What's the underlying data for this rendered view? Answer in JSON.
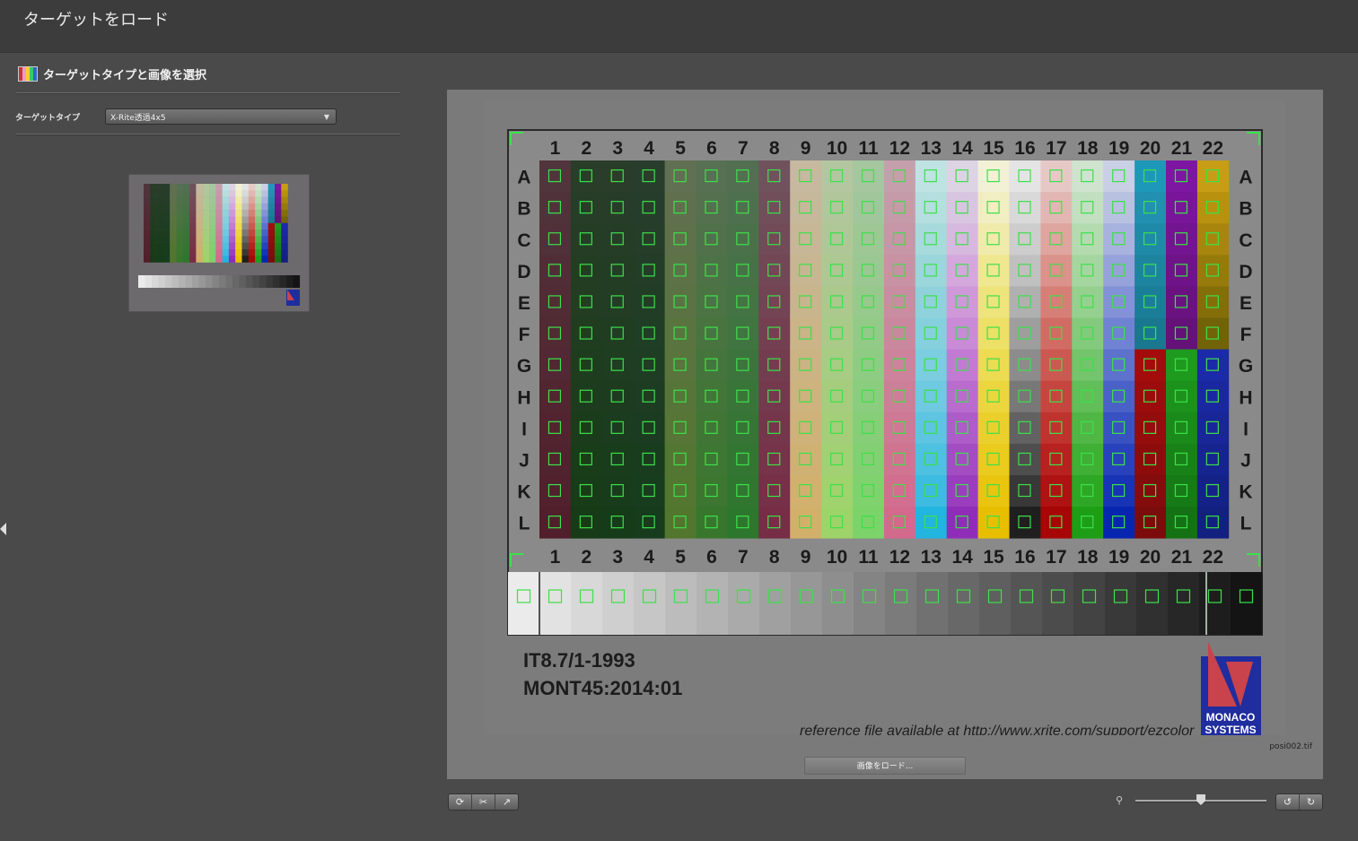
{
  "window": {
    "title": "ターゲットをロード"
  },
  "section": {
    "title": "ターゲットタイプと画像を選択"
  },
  "target_type": {
    "label": "ターゲットタイプ",
    "selected": "X-Rite透過4x5"
  },
  "icons": {
    "section": "target-image-icon",
    "collapse": "triangle-left-icon",
    "dropdown": "chevron-down-icon",
    "tools": [
      "rotate-icon",
      "crop-icon",
      "pick-icon"
    ],
    "zoom": "magnifier-icon",
    "rotate_buttons": [
      "rotate-ccw-icon",
      "rotate-cw-icon"
    ]
  },
  "preview": {
    "filename": "posi002.tif",
    "load_button": "画像をロード...",
    "zoom_level": 0.5
  },
  "target_image": {
    "columns": [
      "1",
      "2",
      "3",
      "4",
      "5",
      "6",
      "7",
      "8",
      "9",
      "10",
      "11",
      "12",
      "13",
      "14",
      "15",
      "16",
      "17",
      "18",
      "19",
      "20",
      "21",
      "22"
    ],
    "rows": [
      "A",
      "B",
      "C",
      "D",
      "E",
      "F",
      "G",
      "H",
      "I",
      "J",
      "K",
      "L"
    ],
    "title_line1": "IT8.7/1-1993",
    "title_line2": "MONT45:2014:01",
    "reference": "reference file available at http://www.xrite.com/support/ezcolor",
    "logo_line1": "MONACO",
    "logo_line2": "SYSTEMS",
    "colors": {
      "logo_blue": "#1f2d9e",
      "logo_red": "#c8434b",
      "marker_green": "#3de04a"
    }
  }
}
